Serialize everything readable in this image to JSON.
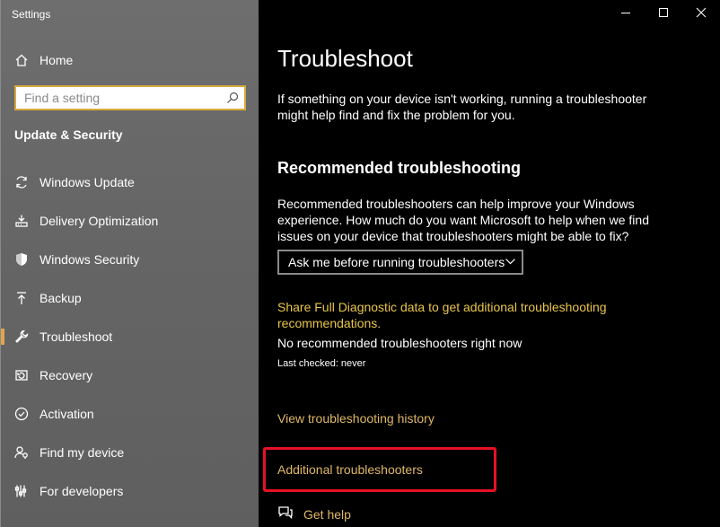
{
  "window": {
    "title": "Settings"
  },
  "sidebar": {
    "home_label": "Home",
    "search": {
      "placeholder": "Find a setting"
    },
    "section_title": "Update & Security",
    "items": [
      {
        "label": "Windows Update",
        "icon": "refresh-icon"
      },
      {
        "label": "Delivery Optimization",
        "icon": "delivery-icon"
      },
      {
        "label": "Windows Security",
        "icon": "shield-icon"
      },
      {
        "label": "Backup",
        "icon": "backup-icon"
      },
      {
        "label": "Troubleshoot",
        "icon": "wrench-icon",
        "selected": true
      },
      {
        "label": "Recovery",
        "icon": "recovery-icon"
      },
      {
        "label": "Activation",
        "icon": "checkmark-circle-icon"
      },
      {
        "label": "Find my device",
        "icon": "person-pin-icon"
      },
      {
        "label": "For developers",
        "icon": "developer-icon"
      }
    ]
  },
  "main": {
    "title": "Troubleshoot",
    "intro": "If something on your device isn't working, running a troubleshooter might help find and fix the problem for you.",
    "recommended": {
      "heading": "Recommended troubleshooting",
      "description": "Recommended troubleshooters can help improve your Windows experience. How much do you want Microsoft to help when we find issues on your device that troubleshooters might be able to fix?",
      "dropdown_value": "Ask me before running troubleshooters",
      "diagnostic_link": "Share Full Diagnostic data to get additional troubleshooting recommendations.",
      "status": "No recommended troubleshooters right now",
      "last_checked": "Last checked: never"
    },
    "history_link": "View troubleshooting history",
    "additional_link": "Additional troubleshooters",
    "help_link": "Get help"
  },
  "colors": {
    "accent": "#e0a64d",
    "link": "#e0b765",
    "highlight": "#e81123"
  }
}
